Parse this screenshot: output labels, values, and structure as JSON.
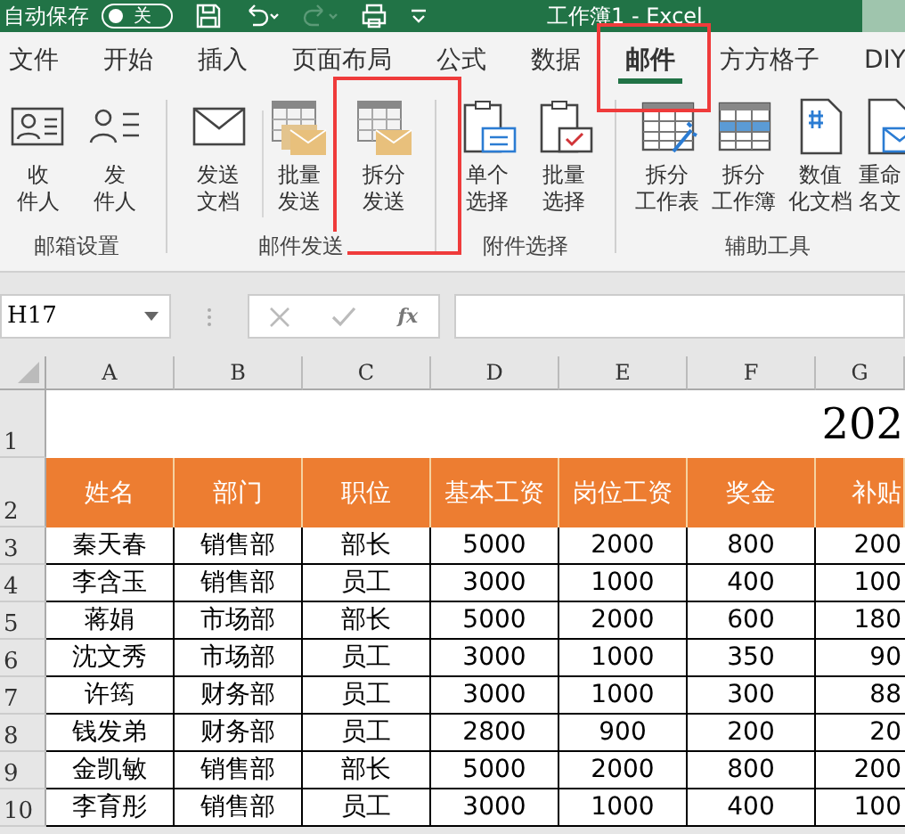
{
  "title_bar": {
    "autosave_label": "自动保存",
    "autosave": {
      "on": false,
      "text": "关"
    },
    "title": "工作簿1 - Excel"
  },
  "tabs": [
    {
      "label": "文件",
      "selected": false
    },
    {
      "label": "开始",
      "selected": false
    },
    {
      "label": "插入",
      "selected": false
    },
    {
      "label": "页面布局",
      "selected": false
    },
    {
      "label": "公式",
      "selected": false
    },
    {
      "label": "数据",
      "selected": false
    },
    {
      "label": "邮件",
      "selected": true
    },
    {
      "label": "方方格子",
      "selected": false
    },
    {
      "label": "DIY",
      "selected": false
    }
  ],
  "ribbon": {
    "groups": [
      {
        "label": "邮箱设置",
        "buttons": [
          {
            "lines": [
              "收",
              "件人"
            ]
          },
          {
            "lines": [
              "发",
              "件人"
            ]
          }
        ]
      },
      {
        "label": "邮件发送",
        "buttons": [
          {
            "lines": [
              "发送",
              "文档"
            ]
          },
          {
            "lines": [
              "批量",
              "发送"
            ]
          },
          {
            "lines": [
              "拆分",
              "发送"
            ]
          }
        ]
      },
      {
        "label": "附件选择",
        "buttons": [
          {
            "lines": [
              "单个",
              "选择"
            ]
          },
          {
            "lines": [
              "批量",
              "选择"
            ]
          }
        ]
      },
      {
        "label": "辅助工具",
        "buttons": [
          {
            "lines": [
              "拆分",
              "工作表"
            ]
          },
          {
            "lines": [
              "拆分",
              "工作簿"
            ]
          },
          {
            "lines": [
              "数值",
              "化文档"
            ]
          },
          {
            "lines": [
              "重命",
              "名文"
            ]
          }
        ]
      }
    ]
  },
  "formula_bar": {
    "name_box": "H17",
    "fx": "fx"
  },
  "sheet": {
    "columns": [
      "A",
      "B",
      "C",
      "D",
      "E",
      "F",
      "G"
    ],
    "title_row": {
      "number": "1",
      "text": "202"
    },
    "header_row": {
      "number": "2",
      "cells": [
        "姓名",
        "部门",
        "职位",
        "基本工资",
        "岗位工资",
        "奖金",
        "补贴"
      ]
    },
    "rows": [
      {
        "number": "3",
        "cells": [
          "秦天春",
          "销售部",
          "部长",
          "5000",
          "2000",
          "800",
          "200"
        ]
      },
      {
        "number": "4",
        "cells": [
          "李含玉",
          "销售部",
          "员工",
          "3000",
          "1000",
          "400",
          "100"
        ]
      },
      {
        "number": "5",
        "cells": [
          "蒋娟",
          "市场部",
          "部长",
          "5000",
          "2000",
          "600",
          "180"
        ]
      },
      {
        "number": "6",
        "cells": [
          "沈文秀",
          "市场部",
          "员工",
          "3000",
          "1000",
          "350",
          "90"
        ]
      },
      {
        "number": "7",
        "cells": [
          "许筠",
          "财务部",
          "员工",
          "3000",
          "1000",
          "300",
          "88"
        ]
      },
      {
        "number": "8",
        "cells": [
          "钱发弟",
          "财务部",
          "员工",
          "2800",
          "900",
          "200",
          "20"
        ]
      },
      {
        "number": "9",
        "cells": [
          "金凯敏",
          "销售部",
          "部长",
          "5000",
          "2000",
          "800",
          "200"
        ]
      },
      {
        "number": "10",
        "cells": [
          "李育彤",
          "销售部",
          "员工",
          "3000",
          "1000",
          "400",
          "100"
        ]
      }
    ]
  }
}
